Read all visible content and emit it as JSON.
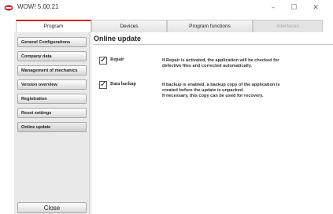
{
  "window": {
    "title": "WOW! 5.00.21",
    "controls": {
      "minimize": "–",
      "maximize": "☐",
      "close": "✕"
    }
  },
  "tabs": [
    {
      "label": "Program",
      "active": true
    },
    {
      "label": "Devices"
    },
    {
      "label": "Program functions"
    },
    {
      "label": "Interfaces",
      "disabled": true
    }
  ],
  "sidebar": {
    "items": [
      {
        "label": "General Configurations"
      },
      {
        "label": "Company data"
      },
      {
        "label": "Management of mechanics"
      },
      {
        "label": "Version overview"
      },
      {
        "label": "Registration"
      },
      {
        "label": "Reset settings"
      },
      {
        "label": "Online update",
        "active": true
      }
    ],
    "close_label": "Close"
  },
  "main": {
    "title": "Online update",
    "options": [
      {
        "label": "Repair",
        "checked": true,
        "description": [
          "If Repair is activated, the application will be checked for",
          "defective files and corrected automatically."
        ]
      },
      {
        "label": "Data backup",
        "checked": true,
        "description": [
          "If backup is enabled, a backup copy of the application is",
          "created before the update is unpacked.",
          "If necessary, this copy can be used for recovery."
        ]
      }
    ]
  },
  "colors": {
    "accent": "#c8232c",
    "sidebar_bg": "#e9e9e9"
  },
  "icons": {
    "app": "wow-app-icon",
    "check": "check-icon"
  }
}
